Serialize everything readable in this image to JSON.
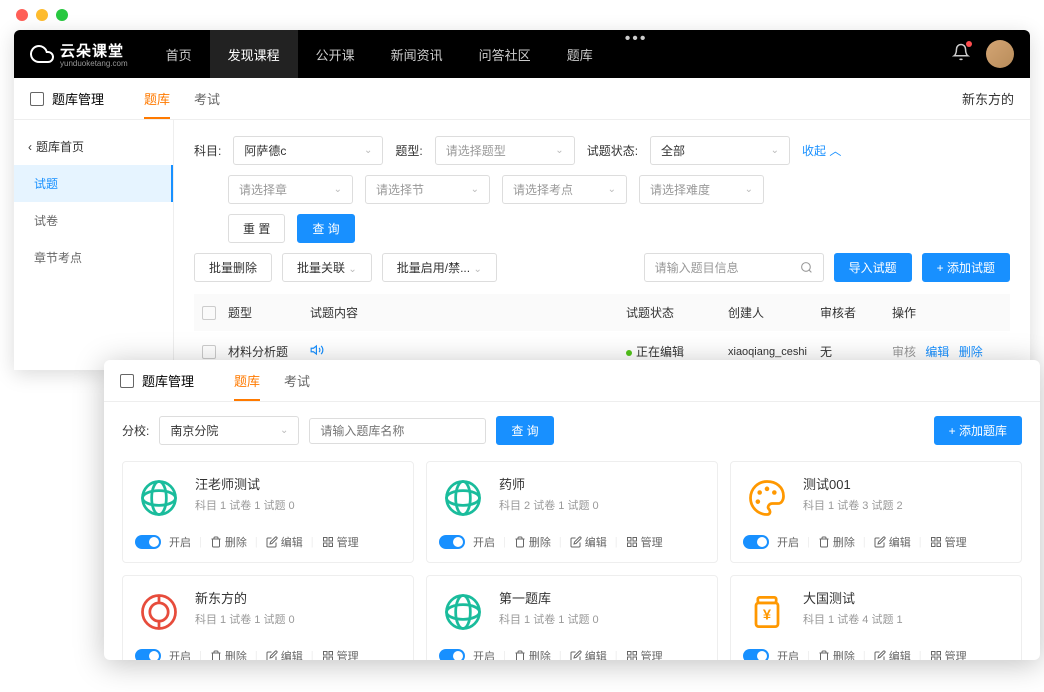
{
  "logo": {
    "text": "云朵课堂",
    "sub": "yunduoketang.com"
  },
  "nav": {
    "items": [
      "首页",
      "发现课程",
      "公开课",
      "新闻资讯",
      "问答社区",
      "题库"
    ],
    "activeIndex": 1
  },
  "window1": {
    "title": "题库管理",
    "tabs": [
      "题库",
      "考试"
    ],
    "activeTab": 0,
    "breadcrumbRight": "新东方的",
    "sidebar": {
      "back": "题库首页",
      "items": [
        "试题",
        "试卷",
        "章节考点"
      ],
      "activeIndex": 0
    },
    "filters": {
      "subjectLabel": "科目:",
      "subjectValue": "阿萨德c",
      "typeLabel": "题型:",
      "typePlaceholder": "请选择题型",
      "statusLabel": "试题状态:",
      "statusValue": "全部",
      "collapseLabel": "收起",
      "chapterPlaceholder": "请选择章",
      "sectionPlaceholder": "请选择节",
      "pointPlaceholder": "请选择考点",
      "difficultyPlaceholder": "请选择难度",
      "resetBtn": "重 置",
      "queryBtn": "查 询"
    },
    "actions": {
      "batchDelete": "批量删除",
      "batchRelate": "批量关联",
      "batchEnable": "批量启用/禁...",
      "searchPlaceholder": "请输入题目信息",
      "importBtn": "导入试题",
      "addBtn": "+ 添加试题"
    },
    "table": {
      "headers": {
        "type": "题型",
        "content": "试题内容",
        "status": "试题状态",
        "creator": "创建人",
        "reviewer": "审核者",
        "actions": "操作"
      },
      "rows": [
        {
          "type": "材料分析题",
          "status": "正在编辑",
          "creator": "xiaoqiang_ceshi",
          "reviewer": "无",
          "review": "审核",
          "edit": "编辑",
          "delete": "删除"
        }
      ]
    }
  },
  "window2": {
    "title": "题库管理",
    "tabs": [
      "题库",
      "考试"
    ],
    "activeTab": 0,
    "filters": {
      "branchLabel": "分校:",
      "branchValue": "南京分院",
      "searchPlaceholder": "请输入题库名称",
      "queryBtn": "查 询",
      "addBtn": "+ 添加题库"
    },
    "cardActions": {
      "open": "开启",
      "delete": "删除",
      "edit": "编辑",
      "manage": "管理"
    },
    "cards": [
      {
        "icon": "globe-green",
        "title": "汪老师测试",
        "meta": "科目 1  试卷 1  试题 0"
      },
      {
        "icon": "globe-green",
        "title": "药师",
        "meta": "科目 2  试卷 1  试题 0"
      },
      {
        "icon": "palette-orange",
        "title": "测试001",
        "meta": "科目 1  试卷 3  试题 2"
      },
      {
        "icon": "coin-red",
        "title": "新东方的",
        "meta": "科目 1  试卷 1  试题 0"
      },
      {
        "icon": "globe-green",
        "title": "第一题库",
        "meta": "科目 1  试卷 1  试题 0"
      },
      {
        "icon": "jar-orange",
        "title": "大国测试",
        "meta": "科目 1  试卷 4  试题 1"
      }
    ]
  }
}
